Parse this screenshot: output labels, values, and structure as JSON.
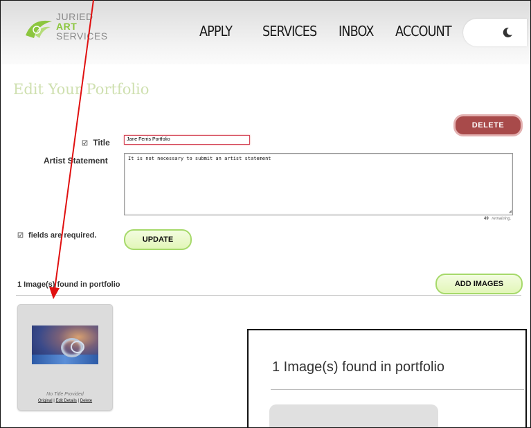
{
  "app": {
    "logo_line1": "JURIED",
    "logo_line2": "ART",
    "logo_line3": "SERVICES"
  },
  "nav": {
    "apply": "APPLY",
    "services": "SERVICES",
    "inbox": "INBOX",
    "account": "ACCOUNT",
    "theme_toggle_icon": "moon-icon"
  },
  "page": {
    "title": "Edit Your Portfolio"
  },
  "form": {
    "delete_label": "DELETE",
    "required_mark": "☑",
    "title_label": "Title",
    "title_value": "Jane Ferris Portfolio",
    "statement_label": "Artist Statement",
    "statement_value": "It is not necessary to submit an artist statement",
    "remaining_count": "49",
    "remaining_label": "remaining.",
    "required_note": "fields are required.",
    "update_label": "UPDATE"
  },
  "portfolio": {
    "found_text": "1 Image(s) found in portfolio",
    "add_images_label": "ADD IMAGES",
    "card": {
      "caption": "No Title Provided",
      "link_original": "Original",
      "link_edit": "Edit Details",
      "link_delete": "Delete",
      "separator": "|"
    }
  },
  "zoom_inset": {
    "text": "1 Image(s) found in portfolio"
  },
  "colors": {
    "accent_green": "#8cc63f",
    "delete_red": "#a84a4a",
    "arrow_red": "#e01010"
  }
}
